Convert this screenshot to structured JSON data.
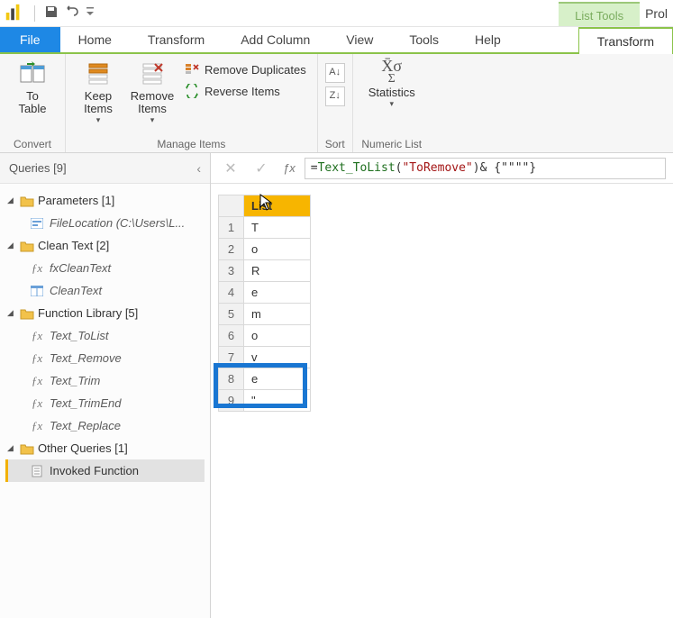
{
  "titlebar": {
    "contextual_tab": "List Tools",
    "right_text": "Prol"
  },
  "ribbon": {
    "file_label": "File",
    "tabs": [
      "Home",
      "Transform",
      "Add Column",
      "View",
      "Tools",
      "Help"
    ],
    "active_ctx_tab": "Transform",
    "groups": {
      "convert": {
        "to_table": "To\nTable",
        "label": "Convert"
      },
      "manage": {
        "keep_items": "Keep\nItems",
        "remove_items": "Remove\nItems",
        "remove_duplicates": "Remove Duplicates",
        "reverse_items": "Reverse Items",
        "label": "Manage Items"
      },
      "sort": {
        "label": "Sort"
      },
      "numeric": {
        "statistics": "Statistics",
        "label": "Numeric List"
      }
    }
  },
  "queries_panel": {
    "title": "Queries [9]",
    "groups": [
      {
        "label": "Parameters [1]",
        "items": [
          {
            "icon": "param",
            "label": "FileLocation (C:\\Users\\L..."
          }
        ]
      },
      {
        "label": "Clean Text [2]",
        "items": [
          {
            "icon": "fx",
            "label": "fxCleanText"
          },
          {
            "icon": "table",
            "label": "CleanText"
          }
        ]
      },
      {
        "label": "Function Library [5]",
        "items": [
          {
            "icon": "fx",
            "label": "Text_ToList"
          },
          {
            "icon": "fx",
            "label": "Text_Remove"
          },
          {
            "icon": "fx",
            "label": "Text_Trim"
          },
          {
            "icon": "fx",
            "label": "Text_TrimEnd"
          },
          {
            "icon": "fx",
            "label": "Text_Replace"
          }
        ]
      },
      {
        "label": "Other Queries [1]",
        "items": [
          {
            "icon": "list",
            "label": "Invoked Function",
            "selected": true
          }
        ]
      }
    ]
  },
  "formula_bar": {
    "prefix": "= ",
    "fn": "Text_ToList",
    "open": "(",
    "arg": "\"ToRemove\"",
    "close": ")",
    "suffix": " & {\"\"\"\"}"
  },
  "datagrid": {
    "column_header": "List",
    "rows": [
      "T",
      "o",
      "R",
      "e",
      "m",
      "o",
      "v",
      "e",
      "\""
    ]
  }
}
